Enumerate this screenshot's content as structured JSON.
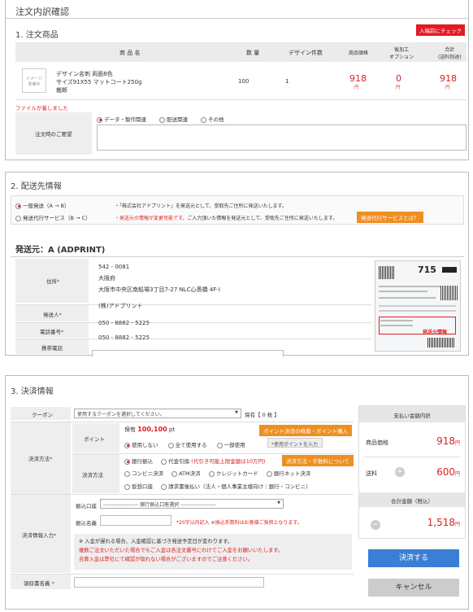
{
  "order": {
    "title": "注文内訳確認",
    "section_title": "1. 注文商品",
    "badge": "入稿前にチェック",
    "table_headers": [
      "商 品 名",
      "数 量",
      "デザイン件数",
      "商品価格",
      "後加工\nオプション",
      "合計\n(送料別途)"
    ],
    "thumb_label": "イメージ\n準備中",
    "product_lines": [
      "デザイン名刺 両面8色",
      "サイズ91X55 マットコート250g",
      "裁断"
    ],
    "quantity": "100",
    "design_count": "1",
    "price": "918",
    "option": "0",
    "total": "918",
    "yen": "円",
    "file_notice": "ファイルが着しました",
    "request_label": "注文時のご要望",
    "request_options": [
      "データ・製作関連",
      "配送関連",
      "その他"
    ]
  },
  "shipping": {
    "section_title": "2. 配送先情報",
    "option1_label": "一般発送（A → B）",
    "option1_desc": "・「株式会社アドプリント」を発送元として、受取先ご住所に発送いたします。",
    "option2_label": "発送代行サービス（B → C）",
    "option2_desc_red": "・発送元の情報が変更可能です。",
    "option2_desc": "ご入力頂いた情報を発送元として、受取先ご住所に発送いたします。",
    "option2_button": "発送代行サービスとは？",
    "sender_title": "発送元：A (ADPRINT)",
    "address_label": "住所",
    "zip": "542 - 0081",
    "pref": "大阪府",
    "address": "大阪市中央区南船場3丁目7-27 NLC心斎橋 4F-I",
    "sender_label": "発送人",
    "sender_value": "(株)アドプリント",
    "phone_label": "電話番号",
    "phone_value": "050 - 8882 - 5225",
    "mobile_label": "携帯電話",
    "mobile_value": "050 - 8882 - 5225",
    "slip_number": "715",
    "slip_label": "発送元情報"
  },
  "payment": {
    "section_title": "3. 決済情報",
    "coupon_label": "クーポン",
    "coupon_placeholder": "使用するクーポンを選択してください。",
    "coupon_owned": "保有【 0 枚 】",
    "point_label": "ポイント",
    "point_owned_prefix": "保有",
    "point_owned_value": "100,100",
    "point_owned_unit": "pt",
    "point_button": "ポイント決済の特典・ポイント購入",
    "point_options": [
      "使用しない",
      "全て使用する",
      "一部使用"
    ],
    "point_input_placeholder": "*使用ポイントを入力",
    "method_group_label": "決済方法",
    "method_label": "決済方法",
    "method_button": "決済方法・手数料について",
    "methods_row1": [
      "銀行振込",
      "代金引換"
    ],
    "cod_note": "(代引き可能上限金額は10万円)",
    "methods_row2": [
      "コンビニ決済",
      "ATM決済",
      "クレジットカード",
      "銀行ネット決済"
    ],
    "methods_row3": [
      "仮想口座",
      "請求書後払い（法人・個人事業主様向け｜銀行・コンビニ）"
    ],
    "transfer_label": "決済情報入力",
    "bank_label": "振込口座",
    "bank_select": "-------------------- 銀行振込口座選択 --------------------",
    "name_label": "振込名義",
    "name_note": "*20字以内記入 ※振込手数料はお客様ご負担となります。",
    "notice_lines": [
      "※ 入金が遅れる場合、入金確認に基づき発送予定日が変わります。"
    ],
    "notice_red_lines": [
      "複数ご注文いただいた場合でもご入金は各注文番号にわけてご入金をお願いいたします。",
      "合算入金は弊社にて確認が取れない場合がございますのでご注意ください。"
    ],
    "receipt_label": "領収書名義",
    "summary_title": "支払い金額内訳",
    "item_price_label": "商品価格",
    "item_price_value": "918",
    "shipping_label": "送料",
    "shipping_value": "600",
    "total_label": "合計金額（税込）",
    "total_value": "1,518",
    "yen": "円",
    "pay_button": "決済する",
    "cancel_button": "キャンセル"
  }
}
